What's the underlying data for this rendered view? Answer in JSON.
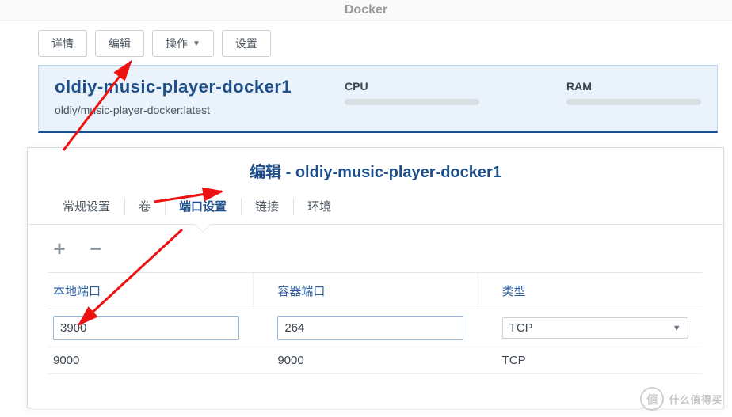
{
  "window_title": "Docker",
  "toolbar": {
    "details": "详情",
    "edit": "编辑",
    "action": "操作",
    "settings": "设置"
  },
  "container": {
    "name": "oldiy-music-player-docker1",
    "image": "oldiy/music-player-docker:latest",
    "cpu_label": "CPU",
    "ram_label": "RAM"
  },
  "dialog": {
    "title": "编辑 - oldiy-music-player-docker1",
    "tabs": {
      "general": "常规设置",
      "volume": "卷",
      "port": "端口设置",
      "link": "链接",
      "env": "环境"
    },
    "headers": {
      "local_port": "本地端口",
      "container_port": "容器端口",
      "type": "类型"
    },
    "rows": [
      {
        "local": "3900",
        "container": "264",
        "type": "TCP",
        "editing": true
      },
      {
        "local": "9000",
        "container": "9000",
        "type": "TCP",
        "editing": false
      }
    ]
  },
  "watermark": {
    "badge": "值",
    "text": "什么值得买"
  }
}
